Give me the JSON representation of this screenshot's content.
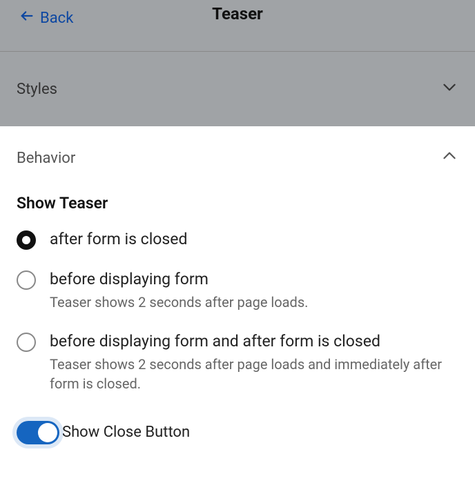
{
  "header": {
    "back_label": "Back",
    "title": "Teaser"
  },
  "sections": {
    "styles": {
      "label": "Styles",
      "expanded": false
    },
    "behavior": {
      "label": "Behavior",
      "expanded": true,
      "group_title": "Show Teaser",
      "options": [
        {
          "label": "after form is closed",
          "caption": "",
          "selected": true
        },
        {
          "label": "before displaying form",
          "caption": "Teaser shows 2 seconds after page loads.",
          "selected": false
        },
        {
          "label": "before displaying form and after form is closed",
          "caption": "Teaser shows 2 seconds after page loads and immediately after form is closed.",
          "selected": false
        }
      ],
      "close_button_toggle": {
        "label": "Show Close Button",
        "enabled": true
      }
    }
  }
}
